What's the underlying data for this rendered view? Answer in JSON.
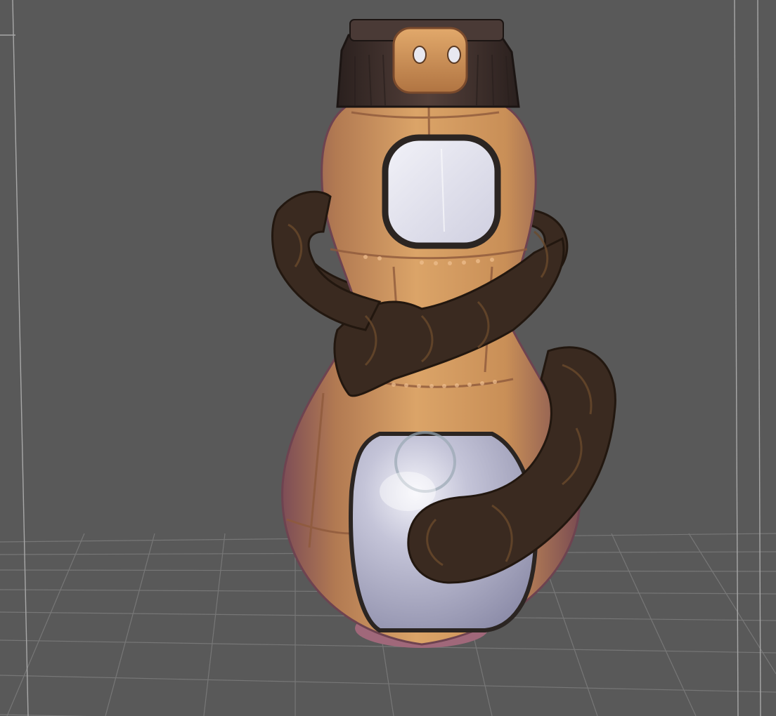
{
  "viewport": {
    "background_color": "#595959",
    "grid_color": "#7a7a7a",
    "grid_highlight_color": "#a8a8a8"
  },
  "model": {
    "body_color": "#c98f57",
    "body_shadow_color": "#7a4c52",
    "rim_color": "#a0687a",
    "cap_color": "#3d2e2b",
    "tube_color": "#3a2a20",
    "tube_highlight_color": "#6a4a2c",
    "window_color": "#e6e6f0",
    "porthole_color": "#b4b4cc",
    "frame_color": "#2b2522"
  }
}
